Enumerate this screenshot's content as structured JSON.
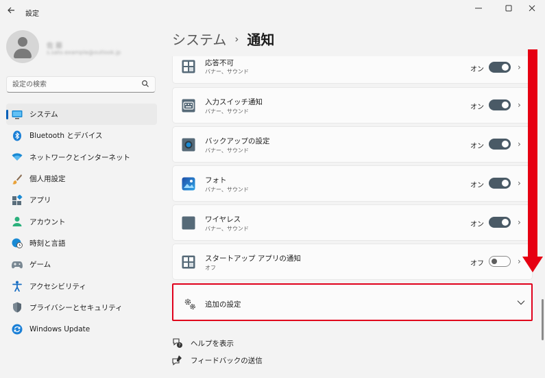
{
  "titlebar": {
    "back_icon": "back-arrow-icon",
    "title": "設定",
    "minimize_icon": "minimize-icon",
    "maximize_icon": "maximize-icon",
    "close_icon": "close-icon"
  },
  "user": {
    "name": "佐 藤",
    "email": "s.sato.example@outlook.jp"
  },
  "search": {
    "placeholder": "設定の検索",
    "icon": "search-icon"
  },
  "sidebar": {
    "items": [
      {
        "label": "システム",
        "icon": "system-icon",
        "active": true
      },
      {
        "label": "Bluetooth とデバイス",
        "icon": "bluetooth-icon"
      },
      {
        "label": "ネットワークとインターネット",
        "icon": "wifi-icon"
      },
      {
        "label": "個人用設定",
        "icon": "brush-icon"
      },
      {
        "label": "アプリ",
        "icon": "apps-icon"
      },
      {
        "label": "アカウント",
        "icon": "account-icon"
      },
      {
        "label": "時刻と言語",
        "icon": "globe-clock-icon"
      },
      {
        "label": "ゲーム",
        "icon": "gamepad-icon"
      },
      {
        "label": "アクセシビリティ",
        "icon": "accessibility-icon"
      },
      {
        "label": "プライバシーとセキュリティ",
        "icon": "shield-icon"
      },
      {
        "label": "Windows Update",
        "icon": "windows-update-icon"
      }
    ]
  },
  "breadcrumb": {
    "parent": "システム",
    "separator": "›",
    "current": "通知"
  },
  "notifications": [
    {
      "title": "応答不可",
      "subtitle": "バナー、サウンド",
      "state": "オン",
      "on": true,
      "icon": "app-grid-icon"
    },
    {
      "title": "入力スイッチ通知",
      "subtitle": "バナー、サウンド",
      "state": "オン",
      "on": true,
      "icon": "keyboard-icon"
    },
    {
      "title": "バックアップの設定",
      "subtitle": "バナー、サウンド",
      "state": "オン",
      "on": true,
      "icon": "backup-icon"
    },
    {
      "title": "フォト",
      "subtitle": "バナー、サウンド",
      "state": "オン",
      "on": true,
      "icon": "photos-icon"
    },
    {
      "title": "ワイヤレス",
      "subtitle": "バナー、サウンド",
      "state": "オン",
      "on": true,
      "icon": "wireless-icon"
    },
    {
      "title": "スタートアップ アプリの通知",
      "subtitle": "オフ",
      "state": "オフ",
      "on": false,
      "icon": "app-grid-icon"
    }
  ],
  "additional": {
    "title": "追加の設定",
    "icon": "gears-icon",
    "chevron": "chevron-down-icon"
  },
  "related": [
    {
      "label": "ヘルプを表示",
      "icon": "help-icon"
    },
    {
      "label": "フィードバックの送信",
      "icon": "feedback-icon"
    }
  ],
  "colors": {
    "accent": "#005fb8",
    "toggle_on": "#4a5a66",
    "highlight": "#e0001b"
  }
}
